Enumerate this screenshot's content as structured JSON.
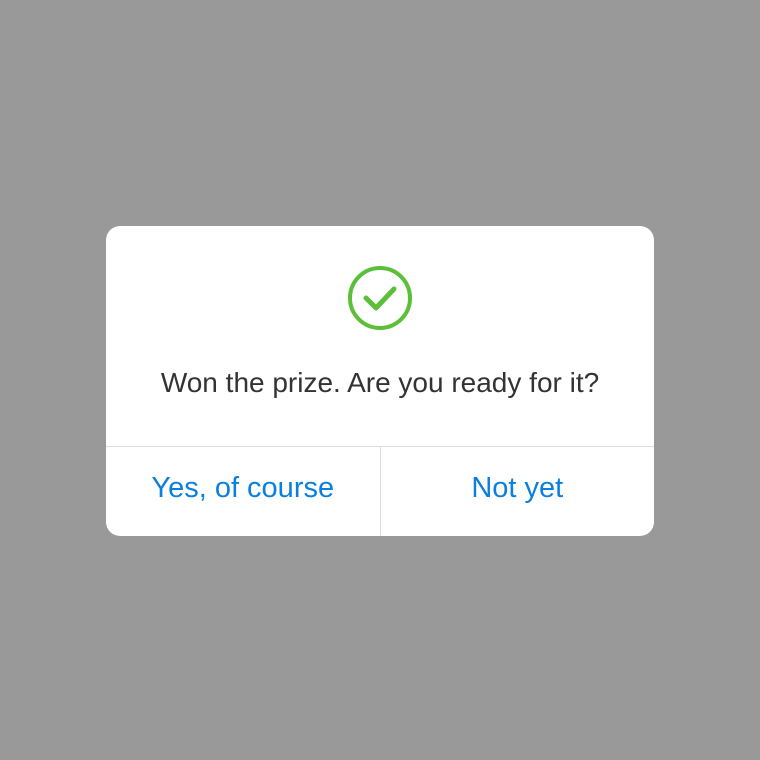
{
  "dialog": {
    "icon": "check-circle-icon",
    "icon_color": "#5cbf3a",
    "message": "Won the prize. Are you ready for it?",
    "buttons": {
      "confirm_label": "Yes, of course",
      "cancel_label": "Not yet"
    },
    "accent_color": "#0a7fe0"
  }
}
